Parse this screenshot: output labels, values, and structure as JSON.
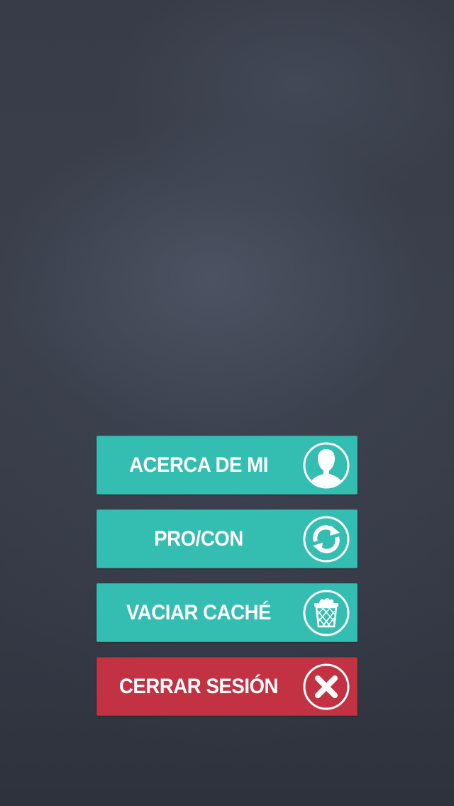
{
  "menu": {
    "items": [
      {
        "label": "ACERCA DE MI",
        "icon": "user-icon",
        "color": "#34bdb1"
      },
      {
        "label": "PRO/CON",
        "icon": "sync-icon",
        "color": "#34bdb1"
      },
      {
        "label": "VACIAR CACHÉ",
        "icon": "trash-icon",
        "color": "#34bdb1"
      },
      {
        "label": "CERRAR SESIÓN",
        "icon": "close-icon",
        "color": "#c23243"
      }
    ]
  }
}
